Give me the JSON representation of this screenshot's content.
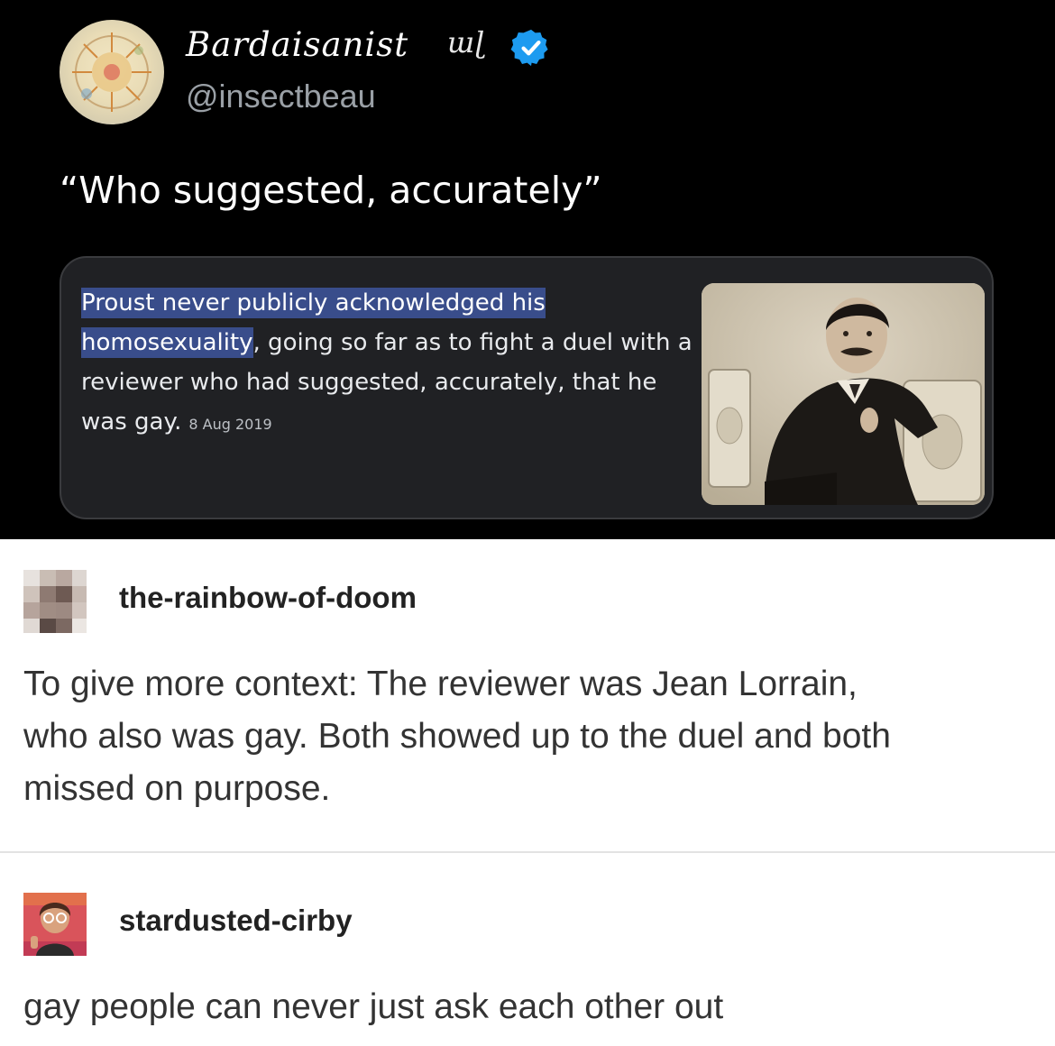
{
  "tweet": {
    "display_name": "Bardaisanist",
    "name_glyph": "ɯɭ",
    "handle": "@insectbeau",
    "text": "“Who suggested, accurately”",
    "snippet": {
      "highlight_line1": "Proust never publicly acknowledged his",
      "highlight_line2": "homosexuality",
      "rest": ", going so far as to fight a duel with a reviewer who had suggested, accurately, that he was gay.",
      "date": "8 Aug 2019"
    }
  },
  "posts": [
    {
      "username": "the-rainbow-of-doom",
      "body": "To give more context: The reviewer was Jean Lorrain, who also was gay. Both showed up to the duel and both missed on purpose."
    },
    {
      "username": "stardusted-cirby",
      "body": "gay people can never just ask each other out"
    }
  ],
  "colors": {
    "tweet_bg": "#000000",
    "verified": "#1d9bf0",
    "highlight": "#394d8b",
    "card_bg": "#202124"
  }
}
